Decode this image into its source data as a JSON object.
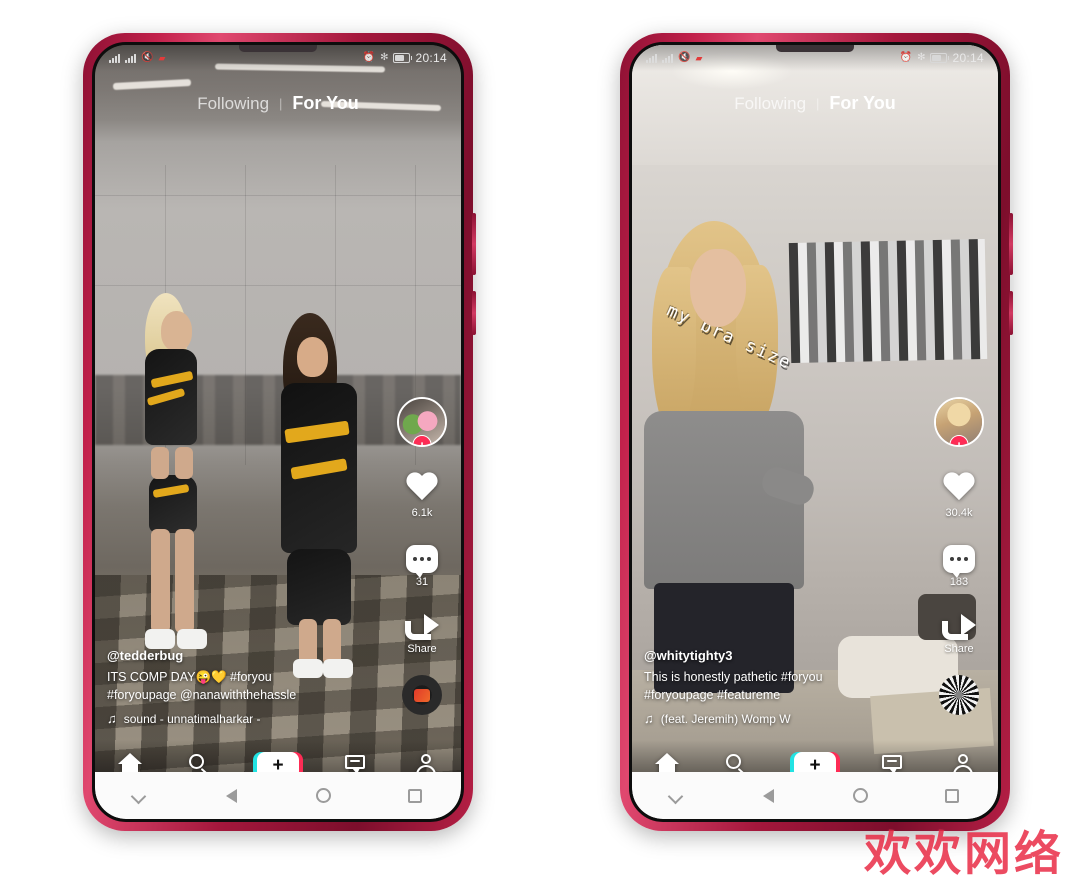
{
  "background_color": "#ffffff",
  "watermark": {
    "text": "欢欢网络",
    "color": "#e8243f"
  },
  "theme": {
    "accent_pink": "#fe2c55",
    "accent_cyan": "#22e3e3",
    "nav_icon_color": "#ffffff",
    "sysnav_icon_color": "#9b9b9b"
  },
  "status_bar": {
    "time": "20:14",
    "icons_left": [
      "signal-bars-icon",
      "signal-bars-icon",
      "mute-icon",
      "alert-icon"
    ],
    "icons_right": [
      "alarm-icon",
      "vibrate-icon",
      "battery-icon"
    ]
  },
  "top_tabs": {
    "following_label": "Following",
    "divider": "|",
    "for_you_label": "For You",
    "active": "For You"
  },
  "tiktok_nav": {
    "items": [
      {
        "name": "home",
        "icon": "home-icon",
        "label": "Home"
      },
      {
        "name": "discover",
        "icon": "search-icon",
        "label": "Discover"
      },
      {
        "name": "create",
        "icon": "plus-icon",
        "label": "+"
      },
      {
        "name": "inbox",
        "icon": "inbox-icon",
        "label": "Inbox"
      },
      {
        "name": "profile",
        "icon": "person-icon",
        "label": "Me"
      }
    ],
    "create_glyph": "+"
  },
  "system_nav": {
    "items": [
      {
        "name": "hide-keyboard",
        "icon": "chevron-down-icon"
      },
      {
        "name": "back",
        "icon": "back-triangle-icon"
      },
      {
        "name": "home",
        "icon": "home-circle-icon"
      },
      {
        "name": "recents",
        "icon": "recents-square-icon"
      }
    ]
  },
  "phones": [
    {
      "id": "left",
      "video": {
        "scene": "two cheerleaders in black and gold uniforms facing each other in a gym hall",
        "overlay_text": ""
      },
      "rail": {
        "avatar_plus": "+",
        "like_count": "6.1k",
        "comment_count": "31",
        "share_label": "Share",
        "disc": "music-disc-red"
      },
      "caption": {
        "username": "@tedderbug",
        "line1": "ITS COMP DAY😜💛 #foryou",
        "line2": "#foryoupage @nanawiththehassle",
        "music_note": "♫",
        "music": "sound - unnatimalharkar -"
      }
    },
    {
      "id": "right",
      "video": {
        "scene": "blonde girl in grey t-shirt standing in a bedroom with a photo collage wall",
        "overlay_text": "my bra size"
      },
      "rail": {
        "avatar_plus": "+",
        "like_count": "30.4k",
        "comment_count": "183",
        "share_label": "Share",
        "disc": "music-disc-striped"
      },
      "caption": {
        "username": "@whitytighty3",
        "line1": "This is honestly pathetic #foryou",
        "line2": "#foryoupage #featureme",
        "music_note": "♫",
        "music": "(feat. Jeremih)   Womp W"
      }
    }
  ]
}
